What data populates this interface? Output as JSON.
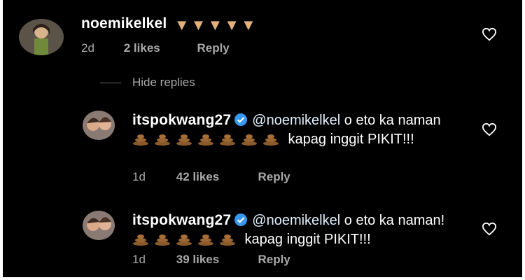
{
  "comments": [
    {
      "username": "noemikelkel",
      "emoji_count": 5,
      "emoji_icon": "thumbs-down-icon",
      "time": "2d",
      "likes": "2 likes",
      "reply": "Reply"
    }
  ],
  "hide_replies": "Hide replies",
  "replies": [
    {
      "username": "itspokwang27",
      "mention": "@noemikelkel",
      "text_before": " o eto ka naman ",
      "emoji_count": 7,
      "emoji_icon": "poop-icon",
      "text_after": " kapag inggit PIKIT!!!",
      "time": "1d",
      "likes": "42 likes",
      "reply": "Reply"
    },
    {
      "username": "itspokwang27",
      "mention": "@noemikelkel",
      "text_before": " o eto ka naman! ",
      "emoji_count": 5,
      "emoji_icon": "poop-icon",
      "text_after": " kapag inggit PIKIT!!!",
      "time": "1d",
      "likes": "39 likes",
      "reply": "Reply"
    }
  ],
  "colors": {
    "background": "#000000",
    "secondary_text": "#a8a8a8",
    "verified": "#3897f0",
    "emoji_skin": "#e2b07a",
    "poop": "#8b5a2b"
  }
}
